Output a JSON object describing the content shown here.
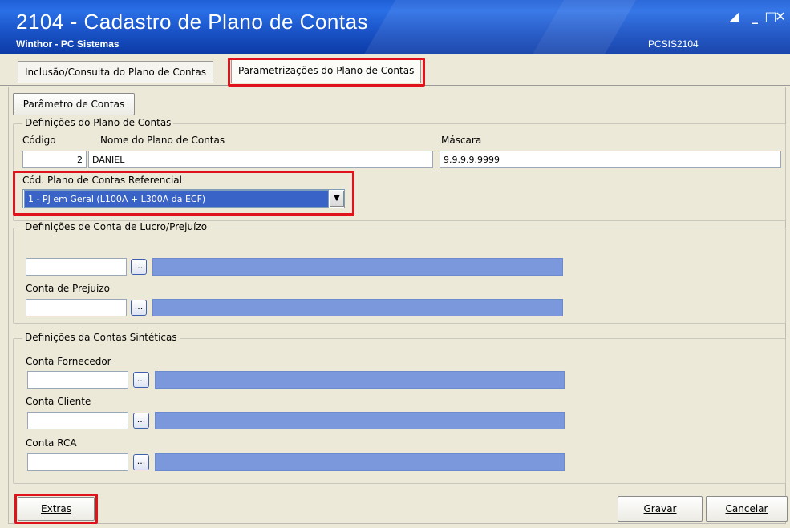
{
  "window": {
    "title": "2104 - Cadastro de Plano de Contas",
    "subtitle": "Winthor - PC Sistemas",
    "program_code": "PCSIS2104"
  },
  "tabs": [
    {
      "label": "Inclusão/Consulta do Plano de Contas"
    },
    {
      "label": "Parametrizações do Plano de Contas"
    }
  ],
  "param_button": "Parâmetro de Contas",
  "plano": {
    "group_label": "Definições do Plano de Contas",
    "codigo_label": "Código",
    "codigo_value": "2",
    "nome_label": "Nome do Plano de Contas",
    "nome_value": "DANIEL",
    "mascara_label": "Máscara",
    "mascara_value": "9.9.9.9.9999",
    "referencial_label": "Cód. Plano de Contas Referencial",
    "referencial_value": "1 - PJ em Geral (L100A + L300A da ECF)"
  },
  "lucro": {
    "group_label": "Definições de Conta de Lucro/Prejuízo",
    "prejuizo_label": "Conta de Prejuízo",
    "lucro_value": "",
    "prejuizo_value": ""
  },
  "sinteticas": {
    "group_label": "Definições da Contas Sintéticas",
    "fornecedor_label": "Conta Fornecedor",
    "cliente_label": "Conta Cliente",
    "rca_label": "Conta RCA"
  },
  "dots_label": "...",
  "footer": {
    "extras": "Extras",
    "gravar": "Gravar",
    "cancelar": "Cancelar"
  },
  "colors": {
    "highlight": "#e0121c",
    "title_bar": "#1b55c9",
    "lookup_fill": "#7b98dc"
  }
}
